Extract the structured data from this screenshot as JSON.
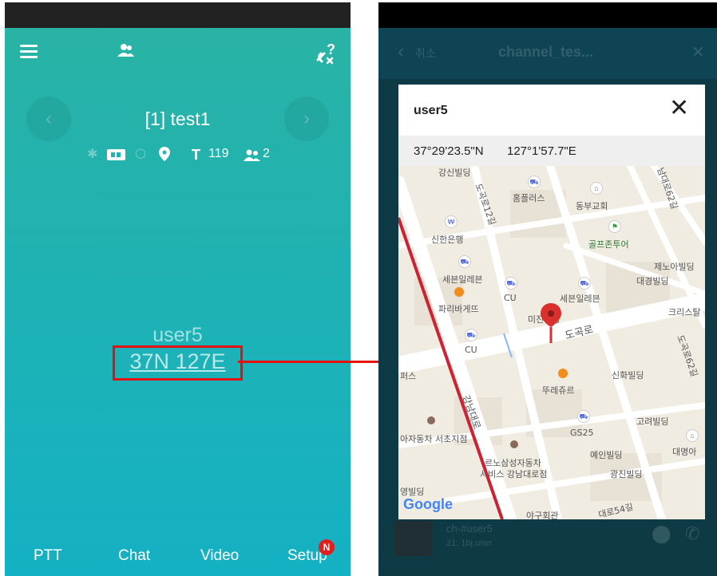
{
  "left": {
    "channel_title": "[1] test1",
    "status": {
      "t_label": "T",
      "count_t": "119",
      "users_count": "2"
    },
    "user_name": "user5",
    "location_link": "37N 127E",
    "bottom_nav": [
      "PTT",
      "Chat",
      "Video",
      "Setup"
    ],
    "setup_badge": "N"
  },
  "right": {
    "bg_back": "취소",
    "bg_title": "channel_tes...",
    "bg_item_name": "ch-#user5",
    "bg_item_sub": "21: 1bj.user",
    "dialog": {
      "user": "user5",
      "lat": "37°29'23.5\"N",
      "lon": "127°1'57.7\"E",
      "close_symbol": "✕"
    },
    "map": {
      "labels": [
        "강신빌딩",
        "홈플러스",
        "동부교회",
        "신한은행",
        "골프존투어",
        "세븐일레븐",
        "제노아빌딩",
        "대경빌딩",
        "CU",
        "세븐일레븐",
        "파리바게뜨",
        "크리스탈",
        "미진빌딩",
        "도곡로",
        "CU",
        "신화빌딩",
        "뚜레쥬르",
        "고려빌딩",
        "GS25",
        "예인빌딩",
        "대명아",
        "광진빌딩",
        "르노삼성자동차",
        "서비스 강남대로점",
        "영빌딩",
        "야구회관",
        "대로54길",
        "강남대로",
        "도곡로12길",
        "남부순환로",
        "아자동차 서초지점",
        "도곡로62길",
        "남대로62길",
        "퍼스"
      ],
      "google_logo": "Google"
    }
  },
  "colors": {
    "teal_top": "#2ab3a4",
    "teal_bottom": "#14b1c4",
    "highlight_red": "#e51010",
    "map_bg": "#f1ece2",
    "road_red": "#cc2233",
    "pin": "#d9302e"
  }
}
